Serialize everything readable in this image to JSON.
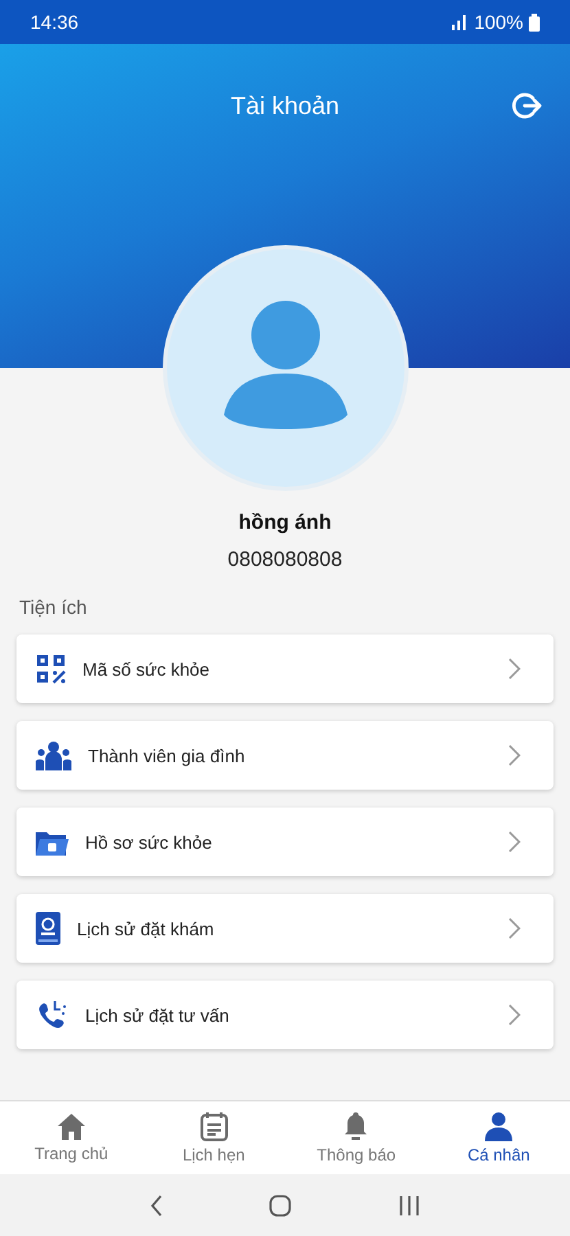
{
  "status_bar": {
    "time": "14:36",
    "battery": "100%"
  },
  "header": {
    "title": "Tài khoản"
  },
  "profile": {
    "name": "hồng ánh",
    "phone": "0808080808"
  },
  "section": {
    "title": "Tiện ích"
  },
  "menu": [
    {
      "label": "Mã số sức khỏe"
    },
    {
      "label": "Thành viên gia đình"
    },
    {
      "label": "Hồ sơ sức khỏe"
    },
    {
      "label": "Lịch sử đặt khám"
    },
    {
      "label": "Lịch sử đặt tư vấn"
    }
  ],
  "bottom_nav": [
    {
      "label": "Trang chủ",
      "selected": false
    },
    {
      "label": "Lịch hẹn",
      "selected": false
    },
    {
      "label": "Thông báo",
      "selected": false
    },
    {
      "label": "Cá nhân",
      "selected": true
    }
  ]
}
